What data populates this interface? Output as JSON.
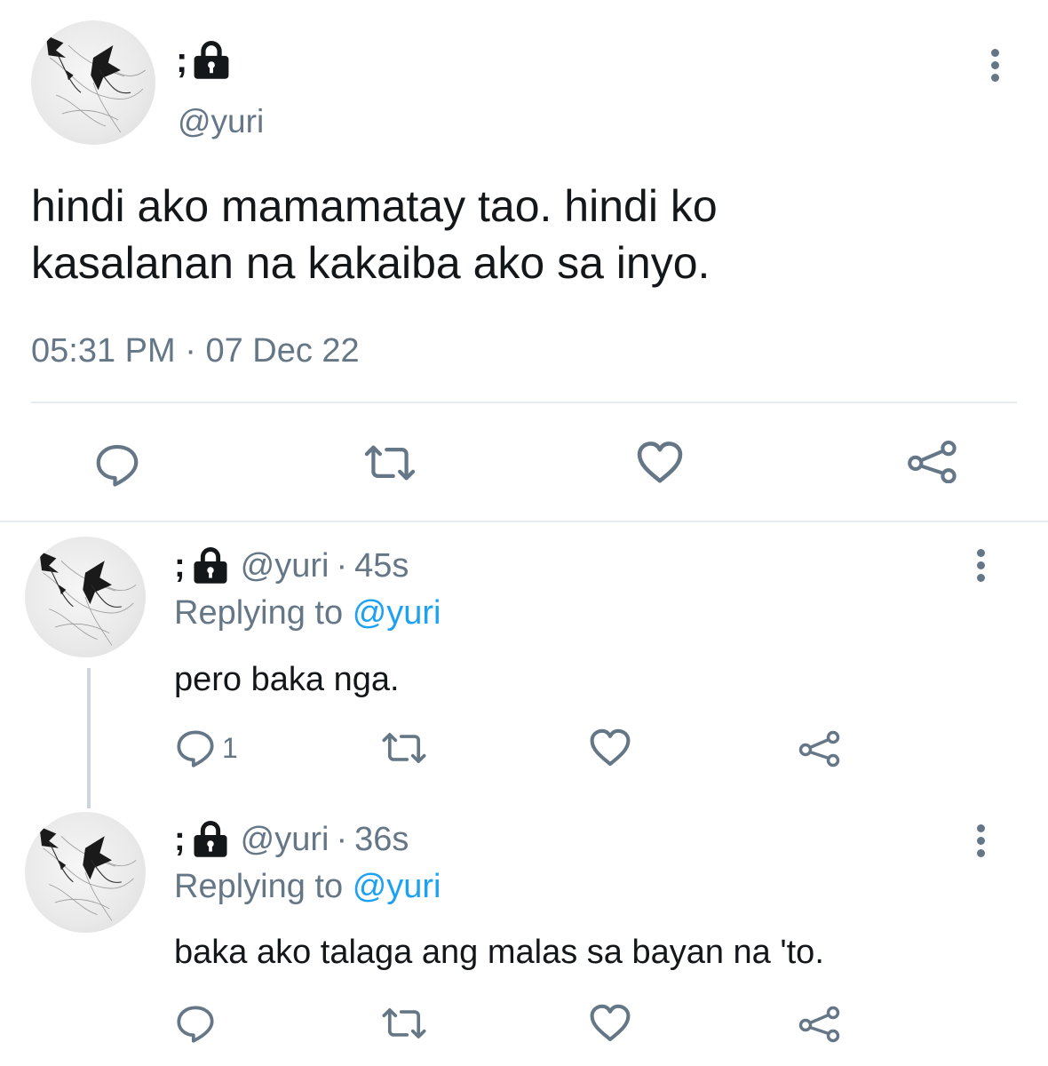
{
  "main_tweet": {
    "display_name": ";",
    "handle": "@yuri",
    "text_line1": "hindi ako mamamatay tao. hindi ko",
    "text_line2": "kasalanan na kakaiba ako sa inyo.",
    "time": "05:31 PM",
    "separator": "·",
    "date": "07 Dec 22",
    "actions": {
      "reply_icon": "reply-bubble-icon",
      "retweet_icon": "retweet-icon",
      "like_icon": "heart-icon",
      "share_icon": "share-icon"
    }
  },
  "replies": [
    {
      "display_name": ";",
      "handle": "@yuri",
      "separator": "·",
      "time_ago": "45s",
      "replying_to_label": "Replying to",
      "replying_to_handle": "@yuri",
      "text": "pero baka nga.",
      "reply_count": "1"
    },
    {
      "display_name": ";",
      "handle": "@yuri",
      "separator": "·",
      "time_ago": "36s",
      "replying_to_label": "Replying to",
      "replying_to_handle": "@yuri",
      "text": "baka ako talaga ang malas sa bayan na 'to.",
      "reply_count": ""
    }
  ],
  "colors": {
    "text": "#14171a",
    "secondary": "#657786",
    "link": "#1da1f2",
    "divider": "#e6ecf0",
    "thread_line": "#ccd6dd"
  }
}
